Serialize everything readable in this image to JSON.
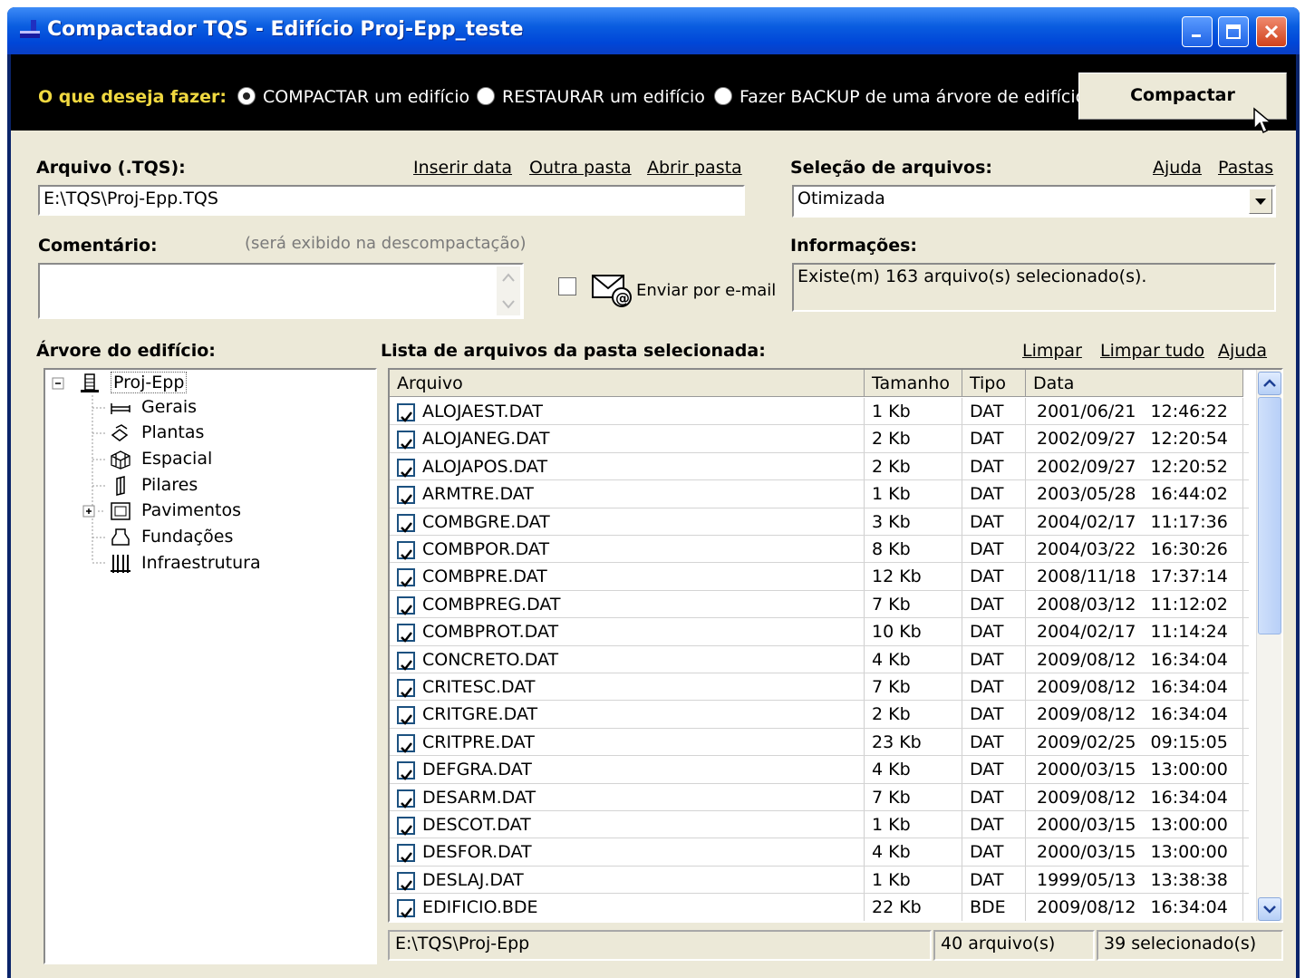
{
  "window": {
    "title": "Compactador TQS - Edifício Proj-Epp_teste"
  },
  "actionbar": {
    "prompt": "O que deseja fazer:",
    "options": [
      {
        "label": "COMPACTAR um edifício",
        "selected": true
      },
      {
        "label": "RESTAURAR um edifício",
        "selected": false
      },
      {
        "label": "Fazer BACKUP de uma árvore de edifícios",
        "selected": false
      }
    ],
    "primary_button": "Compactar"
  },
  "arquivo": {
    "label": "Arquivo (.TQS):",
    "value": "E:\\TQS\\Proj-Epp.TQS",
    "links": [
      "Inserir data",
      "Outra pasta",
      "Abrir pasta"
    ]
  },
  "selecao": {
    "label": "Seleção de arquivos:",
    "value": "Otimizada",
    "links": [
      "Ajuda",
      "Pastas"
    ]
  },
  "comentario": {
    "label": "Comentário:",
    "hint": "(será exibido na descompactação)",
    "value": ""
  },
  "email": {
    "label": "Enviar por e-mail",
    "checked": false
  },
  "informacoes": {
    "label": "Informações:",
    "value": "Existe(m) 163 arquivo(s) selecionado(s)."
  },
  "tree": {
    "label": "Árvore do edifício:",
    "root": "Proj-Epp",
    "items": [
      {
        "label": "Gerais",
        "icon": "beam-icon"
      },
      {
        "label": "Plantas",
        "icon": "plants-icon"
      },
      {
        "label": "Espacial",
        "icon": "spatial-icon"
      },
      {
        "label": "Pilares",
        "icon": "column-icon"
      },
      {
        "label": "Pavimentos",
        "icon": "floor-icon",
        "expandable": true
      },
      {
        "label": "Fundações",
        "icon": "foundation-icon"
      },
      {
        "label": "Infraestrutura",
        "icon": "infrastructure-icon"
      }
    ]
  },
  "filelist": {
    "label": "Lista de arquivos da pasta selecionada:",
    "links": [
      "Limpar",
      "Limpar tudo",
      "Ajuda"
    ],
    "columns": [
      "Arquivo",
      "Tamanho",
      "Tipo",
      "Data"
    ],
    "rows": [
      {
        "name": "ALOJAEST.DAT",
        "size": "1 Kb",
        "type": "DAT",
        "date": "2001/06/21",
        "time": "12:46:22",
        "checked": true
      },
      {
        "name": "ALOJANEG.DAT",
        "size": "2 Kb",
        "type": "DAT",
        "date": "2002/09/27",
        "time": "12:20:54",
        "checked": true
      },
      {
        "name": "ALOJAPOS.DAT",
        "size": "2 Kb",
        "type": "DAT",
        "date": "2002/09/27",
        "time": "12:20:52",
        "checked": true
      },
      {
        "name": "ARMTRE.DAT",
        "size": "1 Kb",
        "type": "DAT",
        "date": "2003/05/28",
        "time": "16:44:02",
        "checked": true
      },
      {
        "name": "COMBGRE.DAT",
        "size": "3 Kb",
        "type": "DAT",
        "date": "2004/02/17",
        "time": "11:17:36",
        "checked": true
      },
      {
        "name": "COMBPOR.DAT",
        "size": "8 Kb",
        "type": "DAT",
        "date": "2004/03/22",
        "time": "16:30:26",
        "checked": true
      },
      {
        "name": "COMBPRE.DAT",
        "size": "12 Kb",
        "type": "DAT",
        "date": "2008/11/18",
        "time": "17:37:14",
        "checked": true
      },
      {
        "name": "COMBPREG.DAT",
        "size": "7 Kb",
        "type": "DAT",
        "date": "2008/03/12",
        "time": "11:12:02",
        "checked": true
      },
      {
        "name": "COMBPROT.DAT",
        "size": "10 Kb",
        "type": "DAT",
        "date": "2004/02/17",
        "time": "11:14:24",
        "checked": true
      },
      {
        "name": "CONCRETO.DAT",
        "size": "4 Kb",
        "type": "DAT",
        "date": "2009/08/12",
        "time": "16:34:04",
        "checked": true
      },
      {
        "name": "CRITESC.DAT",
        "size": "7 Kb",
        "type": "DAT",
        "date": "2009/08/12",
        "time": "16:34:04",
        "checked": true
      },
      {
        "name": "CRITGRE.DAT",
        "size": "2 Kb",
        "type": "DAT",
        "date": "2009/08/12",
        "time": "16:34:04",
        "checked": true
      },
      {
        "name": "CRITPRE.DAT",
        "size": "23 Kb",
        "type": "DAT",
        "date": "2009/02/25",
        "time": "09:15:05",
        "checked": true
      },
      {
        "name": "DEFGRA.DAT",
        "size": "4 Kb",
        "type": "DAT",
        "date": "2000/03/15",
        "time": "13:00:00",
        "checked": true
      },
      {
        "name": "DESARM.DAT",
        "size": "7 Kb",
        "type": "DAT",
        "date": "2009/08/12",
        "time": "16:34:04",
        "checked": true
      },
      {
        "name": "DESCOT.DAT",
        "size": "1 Kb",
        "type": "DAT",
        "date": "2000/03/15",
        "time": "13:00:00",
        "checked": true
      },
      {
        "name": "DESFOR.DAT",
        "size": "4 Kb",
        "type": "DAT",
        "date": "2000/03/15",
        "time": "13:00:00",
        "checked": true
      },
      {
        "name": "DESLAJ.DAT",
        "size": "1 Kb",
        "type": "DAT",
        "date": "1999/05/13",
        "time": "13:38:38",
        "checked": true
      },
      {
        "name": "EDIFICIO.BDE",
        "size": "22 Kb",
        "type": "BDE",
        "date": "2009/08/12",
        "time": "16:34:04",
        "checked": true
      }
    ]
  },
  "statusbar": {
    "path": "E:\\TQS\\Proj-Epp",
    "count": "40 arquivo(s)",
    "selected": "39 selecionado(s)"
  }
}
